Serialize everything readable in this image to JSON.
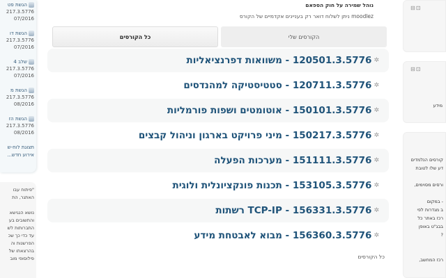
{
  "left_sidebar": {
    "items": [
      {
        "title": "הגשת פט",
        "course": "217.3.5776",
        "date": "07/2016"
      },
      {
        "title": "הגשת דו",
        "course": "217.3.5776",
        "date": "07/2016"
      },
      {
        "title": "שלב 4",
        "course": "217.3.5776",
        "date": "07/2016"
      },
      {
        "title": "הגשת מ",
        "course": "217.3.5776",
        "date": "08/2016"
      },
      {
        "title": "הגשת הז",
        "course": "217.3.5776",
        "date": "08/2016"
      }
    ],
    "calendar_link": "תצוגת לוח-ש",
    "new_event_link": "אירוע חדש...",
    "block2_lines": [
      "\"פיתוח עבו",
      "האתגר, הת",
      "",
      "נושא הנגישא",
      "והתשובים בע",
      "התברותות לש",
      "עד כדי כך שכ",
      "הפרשנות וה",
      "בהרצאתו של",
      "פילוסופי מוב"
    ]
  },
  "main": {
    "notice_title": "נוהל שמירה על  חוק הספאם",
    "notice_text": "moodlez ניתן לשלוח דואר רק בעניינים אקדמיים של הקורס",
    "tabs": [
      {
        "label": "הקורסים שלי"
      },
      {
        "label": "כל הקורסים"
      }
    ],
    "courses": [
      "120501.3.5776 - משוואות דפרנציאליות",
      "120711.3.5776 - סטטיסטיקה למהנדסים",
      "150101.3.5776 - אוטומטים ושפות פורמליות",
      "150217.3.5776 - מיני פרויקט בארגון וניהול קבצים",
      "151111.3.5776 - מערכות הפעלה",
      "153105.3.5776 - תכנות פונקציונלית ולוגית",
      "156331.3.5776 - TCP-IP רשתות",
      "156360.3.5776 - מבוא לאבטחת מידע"
    ],
    "all_courses_link": "כל הקורסים"
  },
  "right_sidebar": {
    "block2_text": "מידע",
    "block3_lines": [
      "קורסים הנלמדים",
      "דע שלו לטובת",
      "",
      "ורסים מסוימים,",
      "",
      "- במקום",
      "ב מגדרות לפי",
      "רכז באתר כל",
      "בבג\"ט באופן",
      "?",
      "",
      "",
      "רכז המחשב,"
    ]
  },
  "colors": {
    "link": "#1f5379",
    "row_shade": "#f6f7f7"
  }
}
